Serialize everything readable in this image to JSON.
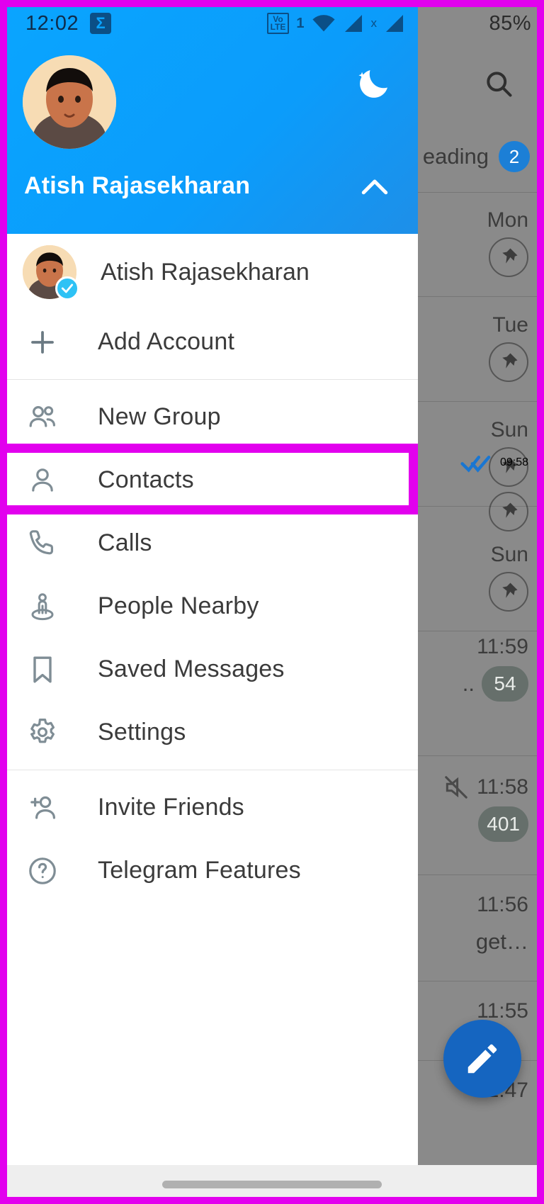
{
  "status_bar": {
    "clock": "12:02",
    "battery_percent": "85%",
    "network_label": "VoLTE",
    "sim_label": "1",
    "roaming_label": "x",
    "icons": [
      "sigma-app-icon",
      "volte-icon",
      "wifi-icon",
      "signal-icon",
      "signal-icon-2"
    ]
  },
  "drawer": {
    "profile": {
      "name": "Atish Rajasekharan",
      "avatar_name": "user-avatar",
      "night_mode_icon": "moon-icon",
      "expand_icon": "chevron-up-icon"
    },
    "accounts": [
      {
        "name": "Atish Rajasekharan",
        "icon": "user-avatar",
        "badge": "verified-check"
      }
    ],
    "add_account": {
      "label": "Add Account",
      "icon": "plus-icon"
    },
    "menu": [
      {
        "label": "New Group",
        "icon": "people-icon",
        "highlighted": false
      },
      {
        "label": "Contacts",
        "icon": "person-icon",
        "highlighted": true
      },
      {
        "label": "Calls",
        "icon": "phone-icon",
        "highlighted": false
      },
      {
        "label": "People Nearby",
        "icon": "people-nearby-icon",
        "highlighted": false
      },
      {
        "label": "Saved Messages",
        "icon": "bookmark-icon",
        "highlighted": false
      },
      {
        "label": "Settings",
        "icon": "gear-icon",
        "highlighted": false
      }
    ],
    "menu_secondary": [
      {
        "label": "Invite Friends",
        "icon": "add-person-icon"
      },
      {
        "label": "Telegram Features",
        "icon": "question-circle-icon"
      }
    ]
  },
  "background": {
    "search_icon": "search-icon",
    "tab": {
      "label": "eading",
      "badge": "2"
    },
    "chat_rows": [
      {
        "time": "Mon",
        "pin": true,
        "badge": "",
        "muted": false,
        "snippet": "",
        "read": false
      },
      {
        "time": "Tue",
        "pin": true,
        "badge": "",
        "muted": false,
        "snippet": "",
        "read": false
      },
      {
        "time": "Sun",
        "pin": true,
        "badge": "",
        "muted": false,
        "snippet": "",
        "read": false
      },
      {
        "time": "09:58",
        "pin": true,
        "badge": "",
        "muted": false,
        "snippet": "",
        "read": true
      },
      {
        "time": "Sun",
        "pin": true,
        "badge": "",
        "muted": false,
        "snippet": "",
        "read": false
      },
      {
        "time": "11:59",
        "pin": false,
        "badge": "54",
        "muted": false,
        "snippet": "..",
        "read": false
      },
      {
        "time": "11:58",
        "pin": false,
        "badge": "401",
        "muted": true,
        "snippet": "",
        "read": false
      },
      {
        "time": "11:56",
        "pin": false,
        "badge": "",
        "muted": false,
        "snippet": "get…",
        "read": false
      },
      {
        "time": "11:55",
        "pin": false,
        "badge": "",
        "muted": false,
        "snippet": "",
        "read": false
      },
      {
        "time": "11:47",
        "pin": false,
        "badge": "",
        "muted": false,
        "snippet": "",
        "read": false
      }
    ],
    "compose_fab": "pencil-icon"
  },
  "navigation_bar": {
    "handle": "gesture-pill"
  },
  "colors": {
    "accent": "#0aa3ff",
    "highlight": "#e200ee",
    "fab": "#1565c0",
    "badge_blue": "#1c7fd6"
  }
}
